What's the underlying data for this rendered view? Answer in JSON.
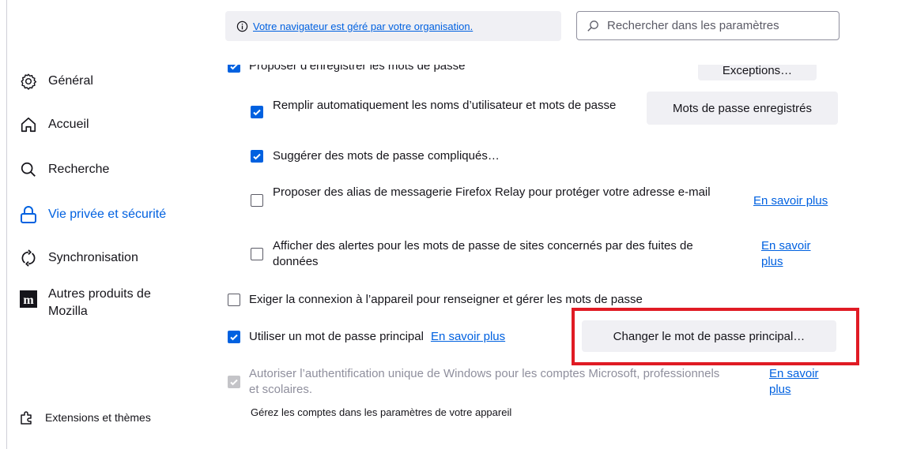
{
  "header": {
    "managed_text": "Votre navigateur est géré par votre organisation.",
    "search_placeholder": "Rechercher dans les paramètres"
  },
  "sidebar": {
    "items": [
      {
        "label": "Général",
        "icon": "gear-icon"
      },
      {
        "label": "Accueil",
        "icon": "home-icon"
      },
      {
        "label": "Recherche",
        "icon": "search-icon"
      },
      {
        "label": "Vie privée et sécurité",
        "icon": "lock-icon",
        "active": true
      },
      {
        "label": "Synchronisation",
        "icon": "sync-icon"
      },
      {
        "label": "Autres produits de Mozilla",
        "icon": "mozilla-logo-icon"
      }
    ],
    "bottom": {
      "label": "Extensions et thèmes",
      "icon": "puzzle-icon"
    }
  },
  "passwords": {
    "offer_save_label": "Proposer d’enregistrer les mots de passe",
    "exceptions_button": "Exceptions…",
    "autofill_label": "Remplir automatiquement les noms d’utilisateur et mots de passe",
    "saved_passwords_button": "Mots de passe enregistrés",
    "suggest_strong_label": "Suggérer des mots de passe compliqués…",
    "relay_label": "Proposer des alias de messagerie Firefox Relay pour protéger votre adresse e-mail",
    "relay_link": "En savoir plus",
    "breach_label": "Afficher des alertes pour les mots de passe de sites concernés par des fuites de données",
    "breach_link": "En savoir plus",
    "device_auth_label": "Exiger la connexion à l’appareil pour renseigner et gérer les mots de passe",
    "primary_password_label": "Utiliser un mot de passe principal",
    "primary_password_link": "En savoir plus",
    "change_primary_button": "Changer le mot de passe principal…",
    "windows_sso_label": "Autoriser l’authentification unique de Windows pour les comptes Microsoft, professionnels et scolaires.",
    "windows_sso_link": "En savoir plus",
    "accounts_hint": "Gérez les comptes dans les paramètres de votre appareil"
  },
  "colors": {
    "accent": "#0061e0",
    "highlight": "#e01b24"
  }
}
